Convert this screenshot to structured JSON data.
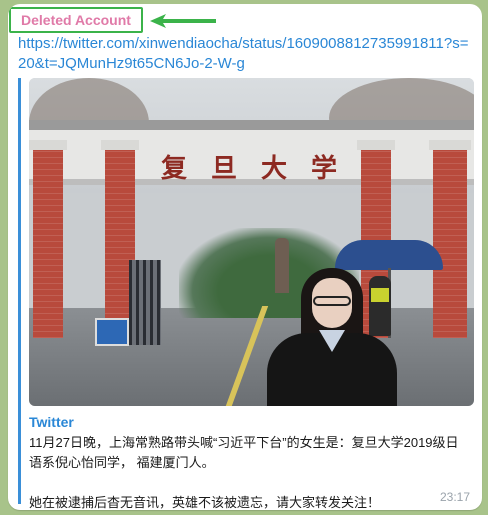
{
  "message": {
    "sender": "Deleted Account",
    "link": "https://twitter.com/xinwendiaocha/status/1609008812735991811?s=20&t=JQMunHz9t65CN6Jo-2-W-g",
    "preview": {
      "site_name": "Twitter",
      "gate_inscription": [
        "复",
        "旦",
        "大",
        "学"
      ],
      "description": "11月27日晚，上海常熟路带头喊“习近平下台”的女生是：复旦大学2019级日语系倪心怡同学，  福建厦门人。\n\n她在被逮捕后杳无音讯，英雄不该被遗忘，请大家转发关注！"
    },
    "time": "23:17"
  },
  "colors": {
    "sender_name": "#e07aa8",
    "highlight_box": "#3bb34a",
    "link": "#2a87d6",
    "preview_bar": "#3a8fd8",
    "chat_background": "#a8c38a"
  },
  "icons": {
    "annotation_arrow": "arrow-left-icon"
  }
}
